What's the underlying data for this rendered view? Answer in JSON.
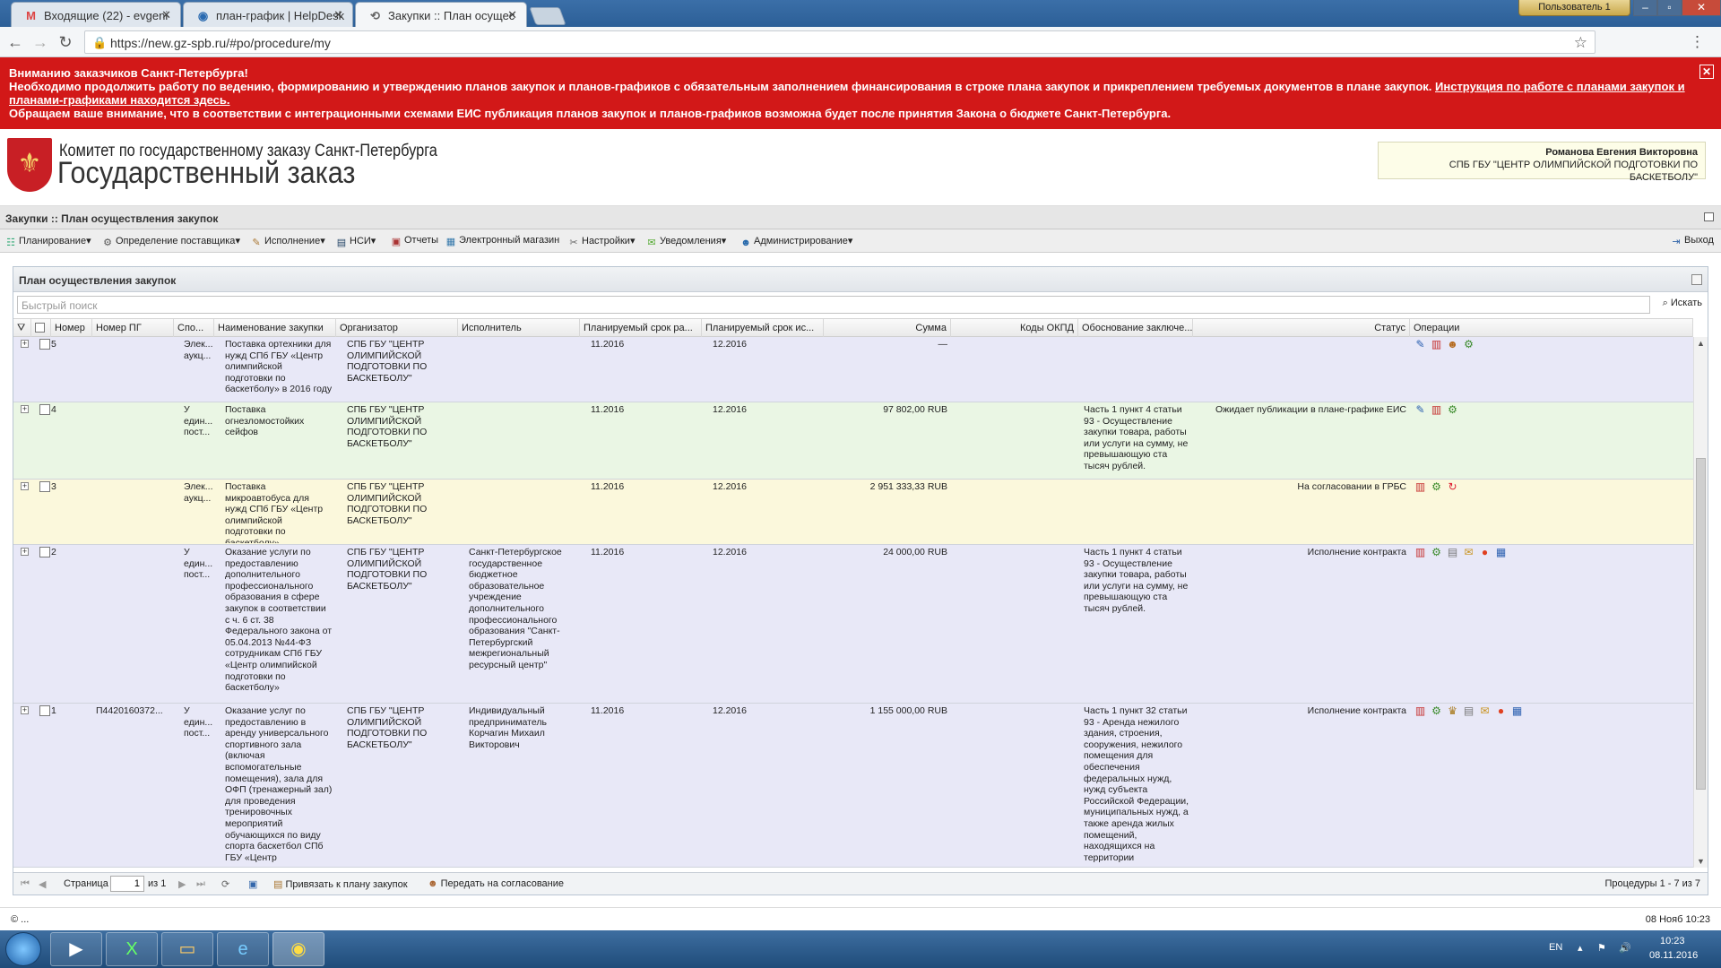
{
  "browser": {
    "tabs": [
      {
        "label": "Входящие (22) - evgeni",
        "icon": "M"
      },
      {
        "label": "план-график | HelpDesk",
        "icon": "◉"
      },
      {
        "label": "Закупки :: План осущес",
        "icon": "⟲"
      }
    ],
    "user_label": "Пользователь 1",
    "url": "https://new.gz-spb.ru/#po/procedure/my"
  },
  "notice": {
    "line1": "Вниманию заказчиков Санкт-Петербурга!",
    "line2": "Необходимо продолжить работу по ведению, формированию и утверждению планов закупок и планов-графиков с обязательным заполнением финансирования в строке плана закупок и прикреплением требуемых документов в плане закупок.",
    "link": "Инструкция по работе с планами закупок и планами-графиками находится здесь.",
    "line3": "Обращаем ваше внимание, что в соответствии с интеграционными схемами ЕИС публикация планов закупок и планов-графиков возможна будет после принятия Закона о бюджете Санкт-Петербурга."
  },
  "header": {
    "org_small": "Комитет по государственному заказу Санкт-Петербурга",
    "org_big": "Государственный заказ",
    "user_name": "Романова Евгения Викторовна",
    "user_org": "СПБ ГБУ \"ЦЕНТР ОЛИМПИЙСКОЙ ПОДГОТОВКИ ПО БАСКЕТБОЛУ\""
  },
  "breadcrumb": "Закупки :: План осуществления закупок",
  "toolbar": {
    "items": [
      "Планирование",
      "Определение поставщика",
      "Исполнение",
      "НСИ",
      "Отчеты",
      "Электронный магазин",
      "Настройки",
      "Уведомления",
      "Администрирование"
    ],
    "exit": "Выход"
  },
  "panel": {
    "title": "План осуществления закупок",
    "search_placeholder": "Быстрый поиск",
    "search_button": "Искать",
    "columns": [
      "Номер",
      "Номер ПГ",
      "Спо...",
      "Наименование закупки",
      "Организатор",
      "Исполнитель",
      "Планируемый срок ра...",
      "Планируемый срок ис...",
      "Сумма",
      "Коды ОКПД",
      "Обоснование заключе...",
      "Статус",
      "Операции"
    ]
  },
  "rows": [
    {
      "num": "5",
      "pg": "",
      "method": "Элек... аукц...",
      "name": "Поставка ортехники для нужд СПб ГБУ «Центр олимпийской подготовки по баскетболу» в 2016 году",
      "org": "СПБ ГБУ \"ЦЕНТР ОЛИМПИЙСКОЙ ПОДГОТОВКИ ПО БАСКЕТБОЛУ\"",
      "executor": "",
      "start": "11.2016",
      "end": "12.2016",
      "sum": "—",
      "okpd": "",
      "basis": "",
      "status": "",
      "bg": "#e8e8f7",
      "ops": [
        "✎",
        "▥",
        "☻",
        "⚙"
      ]
    },
    {
      "num": "4",
      "pg": "",
      "method": "У един... пост...",
      "name": "Поставка огнезломостойких сейфов",
      "org": "СПБ ГБУ \"ЦЕНТР ОЛИМПИЙСКОЙ ПОДГОТОВКИ ПО БАСКЕТБОЛУ\"",
      "executor": "",
      "start": "11.2016",
      "end": "12.2016",
      "sum": "97 802,00 RUB",
      "okpd": "",
      "basis": "Часть 1 пункт 4 статьи 93 - Осуществление закупки товара, работы или услуги на сумму, не превышающую ста тысяч рублей.",
      "status": "Ожидает публикации в плане-графике ЕИС",
      "bg": "#eaf6e4",
      "ops": [
        "✎",
        "▥",
        "⚙"
      ]
    },
    {
      "num": "3",
      "pg": "",
      "method": "Элек... аукц...",
      "name": "Поставка микроавтобуса для нужд СПб ГБУ «Центр олимпийской подготовки по баскетболу»",
      "org": "СПБ ГБУ \"ЦЕНТР ОЛИМПИЙСКОЙ ПОДГОТОВКИ ПО БАСКЕТБОЛУ\"",
      "executor": "",
      "start": "11.2016",
      "end": "12.2016",
      "sum": "2 951 333,33 RUB",
      "okpd": "",
      "basis": "",
      "status": "На согласовании в ГРБС",
      "bg": "#fbf8dc",
      "ops": [
        "▥",
        "⚙",
        "↻"
      ]
    },
    {
      "num": "2",
      "pg": "",
      "method": "У един... пост...",
      "name": "Оказание услуги по предоставлению дополнительного профессионального образования в сфере закупок в соответствии с ч. 6 ст. 38 Федерального закона от 05.04.2013 №44-ФЗ сотрудникам СПб ГБУ «Центр олимпийской подготовки по баскетболу»",
      "org": "СПБ ГБУ \"ЦЕНТР ОЛИМПИЙСКОЙ ПОДГОТОВКИ ПО БАСКЕТБОЛУ\"",
      "executor": "Санкт-Петербургское государственное бюджетное образовательное учреждение дополнительного профессионального образования \"Санкт-Петербургский межрегиональный ресурсный центр\"",
      "start": "11.2016",
      "end": "12.2016",
      "sum": "24 000,00 RUB",
      "okpd": "",
      "basis": "Часть 1 пункт 4 статьи 93 - Осуществление закупки товара, работы или услуги на сумму, не превышающую ста тысяч рублей.",
      "status": "Исполнение контракта",
      "bg": "#e8e8f7",
      "ops": [
        "▥",
        "⚙",
        "▤",
        "✉",
        "●",
        "▦"
      ]
    },
    {
      "num": "1",
      "pg": "П4420160372...",
      "method": "У един... пост...",
      "name": "Оказание услуг по предоставлению в аренду универсального спортивного зала (включая вспомогательные помещения), зала для ОФП (тренажерный зал) для проведения тренировочных мероприятий обучающихся по виду спорта баскетбол СПб ГБУ «Центр",
      "org": "СПБ ГБУ \"ЦЕНТР ОЛИМПИЙСКОЙ ПОДГОТОВКИ ПО БАСКЕТБОЛУ\"",
      "executor": "Индивидуальный предприниматель Корчагин Михаил Викторович",
      "start": "11.2016",
      "end": "12.2016",
      "sum": "1 155 000,00 RUB",
      "okpd": "",
      "basis": "Часть 1 пункт 32 статьи 93 - Аренда нежилого здания, строения, сооружения, нежилого помещения для обеспечения федеральных нужд, нужд субъекта Российской Федерации, муниципальных нужд, а также аренда жилых помещений, находящихся на территории",
      "status": "Исполнение контракта",
      "bg": "#e8e8f7",
      "ops": [
        "▥",
        "⚙",
        "♛",
        "▤",
        "✉",
        "●",
        "▦"
      ]
    }
  ],
  "pager": {
    "page_label": "Страница",
    "page_value": "1",
    "of_label": "из 1",
    "attach": "Привязать к плану закупок",
    "send": "Передать на согласование",
    "summary": "Процедуры 1 - 7 из 7"
  },
  "status": {
    "left": "© ...",
    "right": "08 Нояб 10:23"
  },
  "taskbar": {
    "lang": "EN",
    "time": "10:23",
    "date": "08.11.2016"
  }
}
